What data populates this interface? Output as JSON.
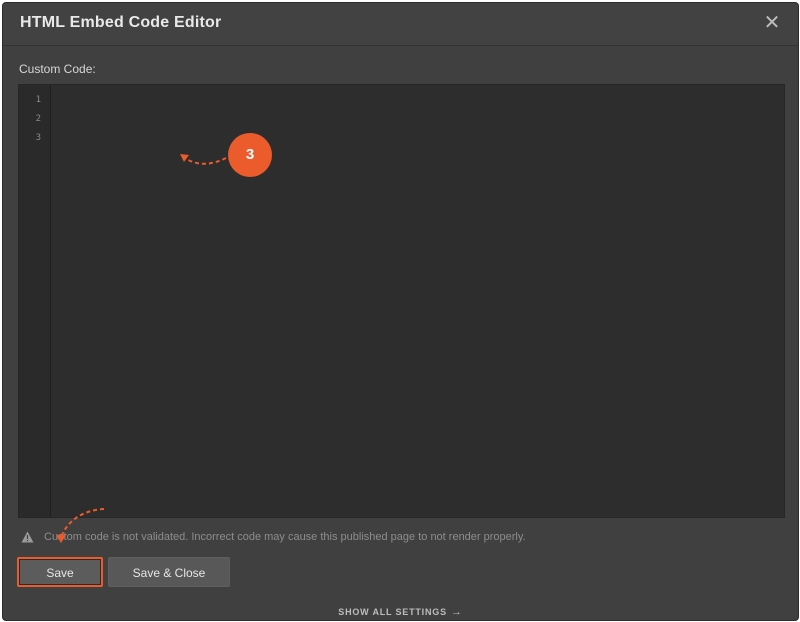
{
  "dialog": {
    "title": "HTML Embed Code Editor",
    "close_icon": "close-icon"
  },
  "editor": {
    "label": "Custom Code:",
    "line_numbers": [
      "1",
      "2",
      "3"
    ],
    "code_value": ""
  },
  "annotation": {
    "step_number": "3",
    "accent_color": "#ec5b2b"
  },
  "warning": {
    "icon": "warning-triangle-icon",
    "text": "Custom code is not validated. Incorrect code may cause this published page to not render properly."
  },
  "buttons": {
    "save_label": "Save",
    "save_close_label": "Save & Close"
  },
  "footer": {
    "show_all_label": "SHOW ALL SETTINGS",
    "arrow": "→"
  }
}
